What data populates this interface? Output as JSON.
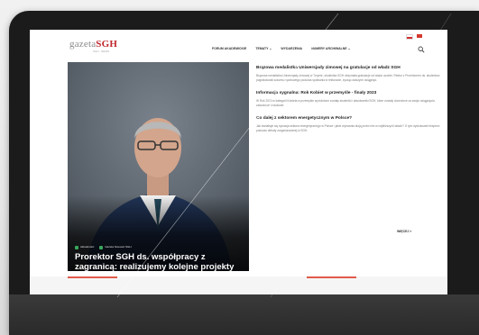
{
  "site": {
    "logo_main": "gazeta",
    "logo_accent": "SGH",
    "logo_sub": "SGH · NEWS",
    "accent_color": "#c0282d"
  },
  "nav": {
    "items": [
      "FORUM AKADEMICKIE",
      "TEMATY ⌄",
      "WYDARZENIA",
      "NUMERY ARCHIWALNE ⌄"
    ],
    "search_icon": "search-icon",
    "lang_pl": "flag-pl-icon",
    "lang_en": "flag-en-icon"
  },
  "hero": {
    "tags": [
      "Aktualności",
      "Gazeta Nowosci SGH"
    ],
    "title": "Prorektor SGH ds. współpracy z zagranicą: realizujemy kolejne projekty ku zwiększeniu umiędzynarodowienia SGH"
  },
  "news": [
    {
      "headline": "Brązowa medalistka Uniwersjady zimowej na gratulacje od władz SGH",
      "excerpt": "Brązowa medalistka Uniwersjady zimowej w Turynie, studentka SGH otrzymała gratulacje od władz uczelni. Rektor z Prorektorem ds. studentów pogratulowali sukcesu sportowego podczas spotkania w rektoracie, życząc dalszych osiągnięć."
    },
    {
      "headline": "Informacja sygnalna: Rok Kobiet w przemyśle - finały 2023",
      "excerpt": "W Rok 2023 w kategorii Kobieta w przemyśle wyróżnione zostały studentki i absolwentki SGH, które zostały docenione za swoje osiągnięcia zawodowe i naukowe."
    },
    {
      "headline": "Co dalej z sektorem energetycznym w Polsce?",
      "excerpt": "Jak kształtuje się sytuacja sektora energetycznego w Polsce i jakie wyzwania stoją przed nim w najbliższych latach? O tym dyskutowali eksperci podczas debaty zorganizowanej w SGH."
    }
  ],
  "more_label": "WIĘCEJ »"
}
